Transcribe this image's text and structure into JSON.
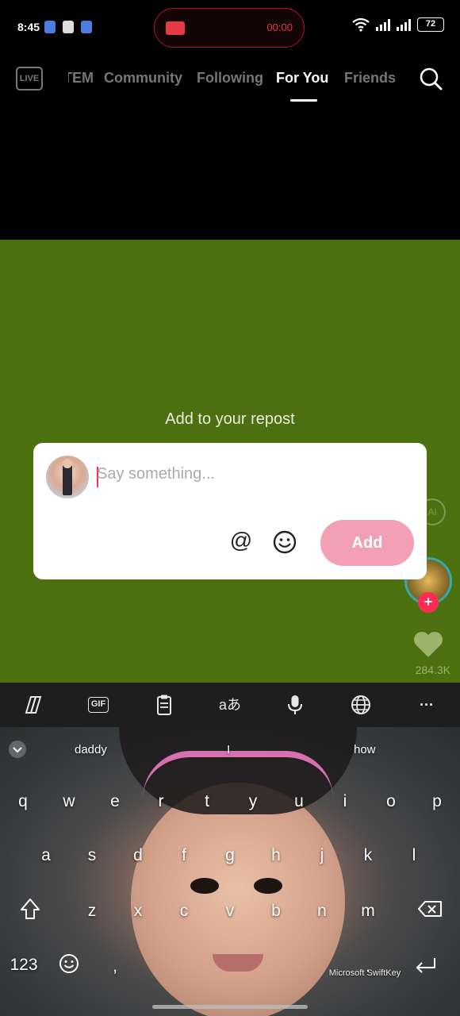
{
  "status_bar": {
    "time": "8:45",
    "recording_time": "00:00",
    "battery": "72"
  },
  "nav": {
    "live_label": "LIVE",
    "tabs": [
      {
        "label": "TEM"
      },
      {
        "label": "Community"
      },
      {
        "label": "Following"
      },
      {
        "label": "For You"
      },
      {
        "label": "Friends"
      }
    ],
    "active_tab": "For You",
    "icons": [
      "live-icon",
      "search-icon"
    ]
  },
  "video": {
    "background_color": "#4c7010",
    "like_count": "284.3K"
  },
  "repost": {
    "title": "Add to your repost",
    "placeholder": "Say something...",
    "add_label": "Add",
    "add_color": "#f4a0b4"
  },
  "keyboard": {
    "toolbar_icons": [
      "copilot-icon",
      "gif-icon",
      "clipboard-icon",
      "translate-icon",
      "mic-icon",
      "globe-icon",
      "more-icon"
    ],
    "gif_label": "GIF",
    "translate_label": "aあ",
    "more_label": "···",
    "suggestions": [
      "daddy",
      "I",
      "how"
    ],
    "rows": [
      [
        "q",
        "w",
        "e",
        "r",
        "t",
        "y",
        "u",
        "i",
        "o",
        "p"
      ],
      [
        "a",
        "s",
        "d",
        "f",
        "g",
        "h",
        "j",
        "k",
        "l"
      ],
      [
        "z",
        "x",
        "c",
        "v",
        "b",
        "n",
        "m"
      ]
    ],
    "numbers_label": "123",
    "space_label": "Microsoft SwiftKey",
    "comma": ",",
    "period": "."
  }
}
